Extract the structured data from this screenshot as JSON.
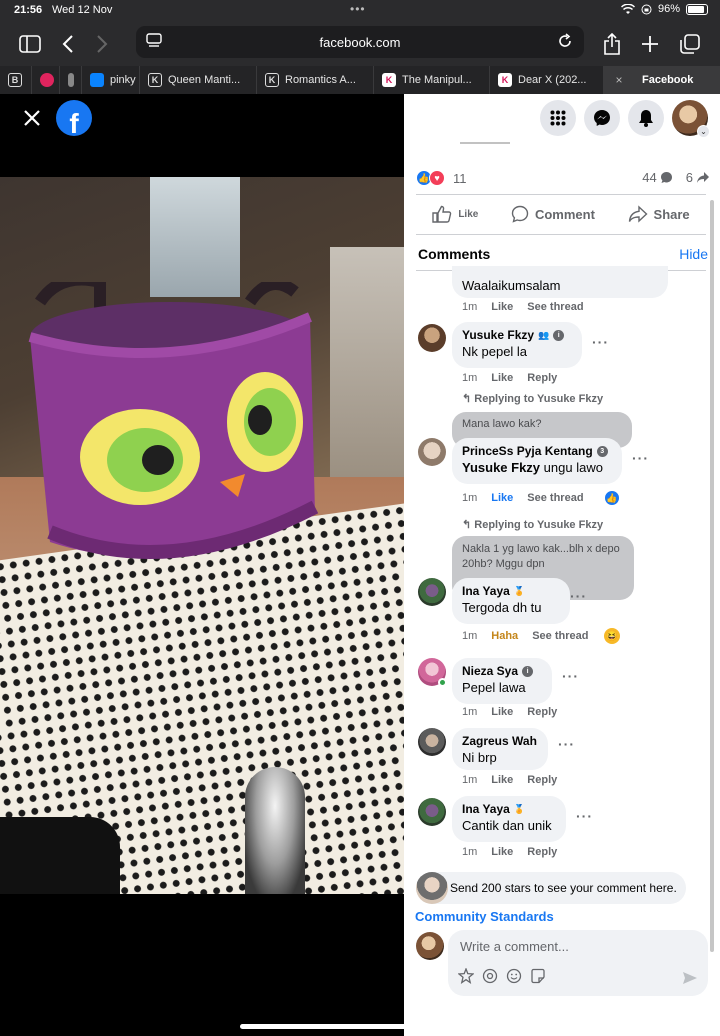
{
  "status_bar": {
    "time": "21:56",
    "date": "Wed 12 Nov",
    "battery": "96%"
  },
  "browser": {
    "url": "facebook.com",
    "tabs": [
      {
        "label": "",
        "favicon": "B"
      },
      {
        "label": "",
        "favicon": "red-app"
      },
      {
        "label": "",
        "favicon": "book"
      },
      {
        "label": "pinky",
        "favicon": "bot"
      },
      {
        "label": "Queen Manti...",
        "favicon": "K"
      },
      {
        "label": "Romantics A...",
        "favicon": "K"
      },
      {
        "label": "The Manipul...",
        "favicon": "K-pink"
      },
      {
        "label": "Dear X (202...",
        "favicon": "K-pink"
      },
      {
        "label": "Facebook",
        "favicon": "close",
        "active": true
      }
    ]
  },
  "post": {
    "reaction_count": "11",
    "comment_count": "44",
    "share_count": "6",
    "actions": {
      "like": "Like",
      "comment": "Comment",
      "share": "Share"
    }
  },
  "comments_section": {
    "title": "Comments",
    "hide_label": "Hide",
    "items": [
      {
        "name": "",
        "text": "Waalaikumsalam",
        "time": "1m",
        "actions": [
          "Like",
          "See thread"
        ]
      },
      {
        "name": "Yusuke Fkzy",
        "text": "Nk pepel la",
        "time": "1m",
        "actions": [
          "Like",
          "Reply"
        ]
      },
      {
        "replying_to": "Replying to Yusuke Fkzy",
        "quote": "Mana lawo kak?",
        "name": "PrinceSs Pyja Kentang",
        "mention": "Yusuke Fkzy",
        "text": "ungu lawo",
        "time": "1m",
        "actions": [
          "Like",
          "See thread"
        ]
      },
      {
        "replying_to": "Replying to Yusuke Fkzy",
        "quote": "Nakla 1 yg lawo kak...blh x depo 20hb? Mggu dpn",
        "name": "Ina Yaya",
        "text": "Tergoda dh tu",
        "time": "1m",
        "actions": [
          "Haha",
          "See thread"
        ]
      },
      {
        "name": "Nieza Sya",
        "text": "Pepel lawa",
        "time": "1m",
        "actions": [
          "Like",
          "Reply"
        ]
      },
      {
        "name": "Zagreus Wah",
        "text": "Ni brp",
        "time": "1m",
        "actions": [
          "Like",
          "Reply"
        ]
      },
      {
        "name": "Ina Yaya",
        "text": "Cantik dan unik",
        "time": "1m",
        "actions": [
          "Like",
          "Reply"
        ]
      }
    ],
    "stars_prompt": "Send 200 stars to see your comment here.",
    "community_standards": "Community Standards",
    "write_placeholder": "Write a comment..."
  },
  "colors": {
    "facebook_blue": "#1877f2",
    "video_bg": "#000000"
  }
}
